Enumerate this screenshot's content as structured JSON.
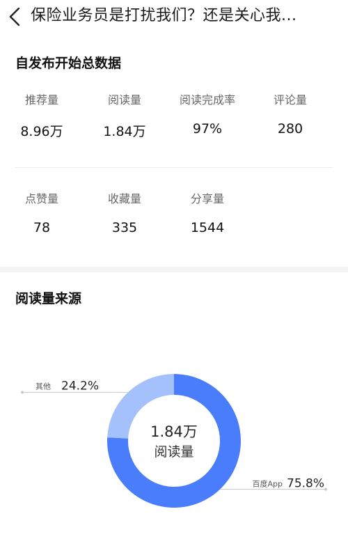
{
  "header": {
    "title": "保险业务员是打扰我们？还是关心我..."
  },
  "overview": {
    "title": "自发布开始总数据",
    "stats": [
      {
        "label": "推荐量",
        "value": "8.96万"
      },
      {
        "label": "阅读量",
        "value": "1.84万"
      },
      {
        "label": "阅读完成率",
        "value": "97%"
      },
      {
        "label": "评论量",
        "value": "280"
      },
      {
        "label": "点赞量",
        "value": "78"
      },
      {
        "label": "收藏量",
        "value": "335"
      },
      {
        "label": "分享量",
        "value": "1544"
      }
    ]
  },
  "source": {
    "title": "阅读量来源"
  },
  "chart_data": {
    "type": "pie",
    "center_value": "1.84万",
    "center_label": "阅读量",
    "slices": [
      {
        "name": "百度App",
        "value": 75.8,
        "label": "75.8%",
        "color": "#4a7dfc"
      },
      {
        "name": "其他",
        "value": 24.2,
        "label": "24.2%",
        "color": "#a5c1fb"
      }
    ]
  }
}
